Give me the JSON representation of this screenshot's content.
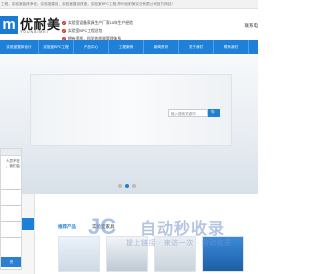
{
  "topbar": {
    "text": "工程，实验室装修净化，实验室建设，实验室建设改造，实验室BPC工程-郑州优耐美实业有限公司官方网站！"
  },
  "header": {
    "logo_mark": "m",
    "logo_cn": "优耐美",
    "logo_en": "YOUNAIMEI",
    "features": [
      "实验室设备家具生产厂家15年生产经验",
      "实验室BPC工程总包",
      "拥有资质，科学的质量管理体系"
    ],
    "contact": "联系电"
  },
  "nav": {
    "items": [
      {
        "label": "实验室整体设计"
      },
      {
        "label": "实验室BPC工程"
      },
      {
        "label": "产品中心"
      },
      {
        "label": "工程案例"
      },
      {
        "label": "新闻资讯"
      },
      {
        "label": "关于我们"
      },
      {
        "label": "联系我们"
      }
    ]
  },
  "banner": {
    "search_placeholder": "输入搜索关键词",
    "search_button": "🔍",
    "dots": [
      false,
      true,
      false
    ]
  },
  "section": {
    "side_title": "推荐产品",
    "tabs": [
      {
        "label": "推荐产品",
        "active": true
      },
      {
        "label": "实验室家具",
        "active": false
      }
    ],
    "products": [
      "",
      "",
      "",
      ""
    ]
  },
  "chat": {
    "lines": [
      "人员不在",
      "，我们会"
    ],
    "button": "完"
  },
  "watermark": {
    "badge": "JC",
    "title": "自动秒收录",
    "slogan": "提上链接 · 来访一次 · 自动收录"
  }
}
